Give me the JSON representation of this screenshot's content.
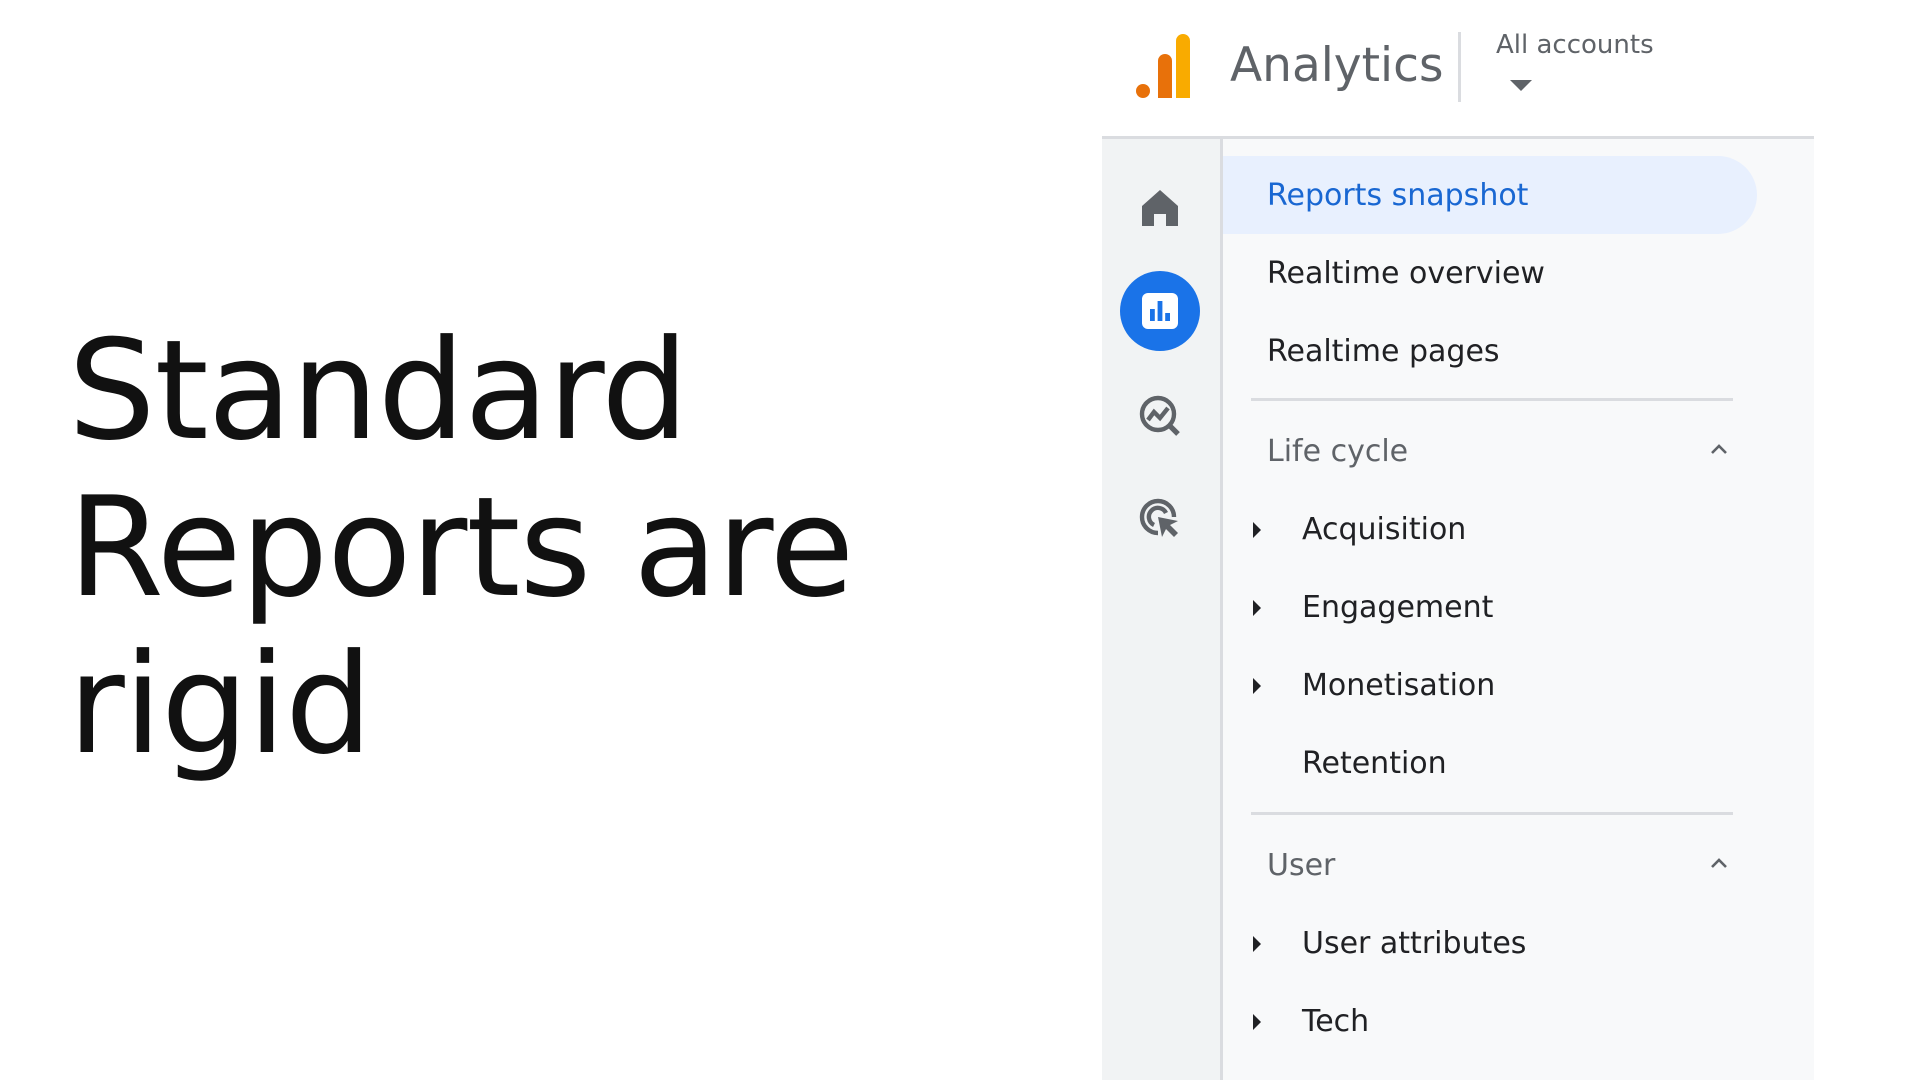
{
  "slide": {
    "title_lines": [
      "Standard",
      "Reports are",
      "rigid"
    ]
  },
  "app": {
    "name": "Analytics",
    "account_selector": "All accounts"
  },
  "rail": {
    "icons": [
      "home-icon",
      "reports-icon",
      "explore-icon",
      "advertising-icon"
    ],
    "active": "reports-icon",
    "accent_color": "#1a73e8"
  },
  "nav": {
    "top_items": [
      {
        "label": "Reports snapshot",
        "selected": true
      },
      {
        "label": "Realtime overview"
      },
      {
        "label": "Realtime pages"
      }
    ],
    "sections": [
      {
        "title": "Life cycle",
        "expanded": true,
        "items": [
          {
            "label": "Acquisition",
            "has_children": true
          },
          {
            "label": "Engagement",
            "has_children": true
          },
          {
            "label": "Monetisation",
            "has_children": true
          },
          {
            "label": "Retention",
            "has_children": false
          }
        ]
      },
      {
        "title": "User",
        "expanded": true,
        "items": [
          {
            "label": "User attributes",
            "has_children": true
          },
          {
            "label": "Tech",
            "has_children": true
          }
        ]
      }
    ],
    "selected_color": "#1967d2"
  }
}
